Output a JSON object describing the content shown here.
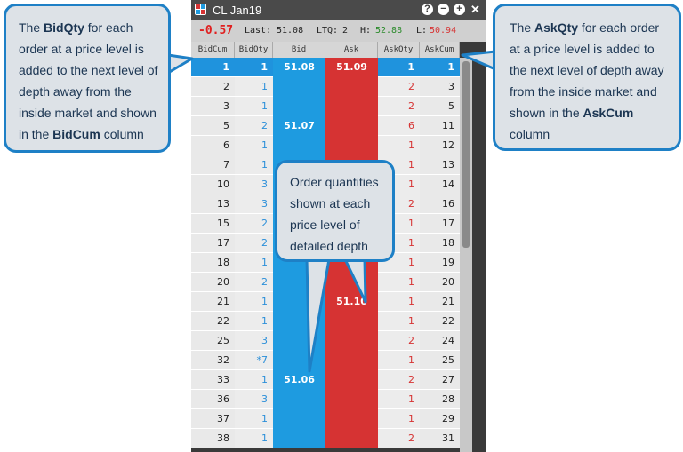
{
  "window": {
    "title": "CL Jan19",
    "controls": [
      {
        "name": "help-icon",
        "glyph": "?"
      },
      {
        "name": "minimize-icon",
        "glyph": "−"
      },
      {
        "name": "add-icon",
        "glyph": "+"
      },
      {
        "name": "close-icon",
        "glyph": "✕"
      }
    ]
  },
  "stats": {
    "net_change": "-0.57",
    "last_label": "Last:",
    "last_value": "51.08",
    "ltq_label": "LTQ:",
    "ltq_value": "2",
    "high_label": "H:",
    "high_value": "52.88",
    "low_label": "L:",
    "low_value": "50.94"
  },
  "columns": [
    "BidCum",
    "BidQty",
    "Bid",
    "Ask",
    "AskQty",
    "AskCum"
  ],
  "rows": [
    {
      "bidcum": "1",
      "bidqty": "1",
      "bid": "51.08",
      "ask": "51.09",
      "askqty": "1",
      "askcum": "1",
      "inside": true
    },
    {
      "bidcum": "2",
      "bidqty": "1",
      "bid": "",
      "ask": "",
      "askqty": "2",
      "askcum": "3"
    },
    {
      "bidcum": "3",
      "bidqty": "1",
      "bid": "",
      "ask": "",
      "askqty": "2",
      "askcum": "5"
    },
    {
      "bidcum": "5",
      "bidqty": "2",
      "bid": "51.07",
      "ask": "",
      "askqty": "6",
      "askcum": "11"
    },
    {
      "bidcum": "6",
      "bidqty": "1",
      "bid": "",
      "ask": "",
      "askqty": "1",
      "askcum": "12"
    },
    {
      "bidcum": "7",
      "bidqty": "1",
      "bid": "",
      "ask": "",
      "askqty": "1",
      "askcum": "13"
    },
    {
      "bidcum": "10",
      "bidqty": "3",
      "bid": "",
      "ask": "",
      "askqty": "1",
      "askcum": "14"
    },
    {
      "bidcum": "13",
      "bidqty": "3",
      "bid": "",
      "ask": "",
      "askqty": "2",
      "askcum": "16"
    },
    {
      "bidcum": "15",
      "bidqty": "2",
      "bid": "",
      "ask": "",
      "askqty": "1",
      "askcum": "17"
    },
    {
      "bidcum": "17",
      "bidqty": "2",
      "bid": "",
      "ask": "",
      "askqty": "1",
      "askcum": "18"
    },
    {
      "bidcum": "18",
      "bidqty": "1",
      "bid": "",
      "ask": "",
      "askqty": "1",
      "askcum": "19"
    },
    {
      "bidcum": "20",
      "bidqty": "2",
      "bid": "",
      "ask": "",
      "askqty": "1",
      "askcum": "20"
    },
    {
      "bidcum": "21",
      "bidqty": "1",
      "bid": "",
      "ask": "51.10",
      "askqty": "1",
      "askcum": "21"
    },
    {
      "bidcum": "22",
      "bidqty": "1",
      "bid": "",
      "ask": "",
      "askqty": "1",
      "askcum": "22"
    },
    {
      "bidcum": "25",
      "bidqty": "3",
      "bid": "",
      "ask": "",
      "askqty": "2",
      "askcum": "24"
    },
    {
      "bidcum": "32",
      "bidqty": "*7",
      "bid": "",
      "ask": "",
      "askqty": "1",
      "askcum": "25"
    },
    {
      "bidcum": "33",
      "bidqty": "1",
      "bid": "51.06",
      "ask": "",
      "askqty": "2",
      "askcum": "27"
    },
    {
      "bidcum": "36",
      "bidqty": "3",
      "bid": "",
      "ask": "",
      "askqty": "1",
      "askcum": "28"
    },
    {
      "bidcum": "37",
      "bidqty": "1",
      "bid": "",
      "ask": "",
      "askqty": "1",
      "askcum": "29"
    },
    {
      "bidcum": "38",
      "bidqty": "1",
      "bid": "",
      "ask": "",
      "askqty": "2",
      "askcum": "31"
    }
  ],
  "callouts": {
    "left": {
      "pre": "The ",
      "bold1": "BidQty",
      "mid": " for each order at a price level is added to the next level of depth away from the inside market and shown in the ",
      "bold2": "BidCum",
      "post": " column"
    },
    "right": {
      "pre": "The ",
      "bold1": "AskQty",
      "mid": " for each order at a price level is added to the next level of depth away from the inside market and shown in the ",
      "bold2": "AskCum",
      "post": " column"
    },
    "center": {
      "text": "Order quantities shown at each price level of detailed depth"
    }
  },
  "colors": {
    "bid": "#1e9be0",
    "ask": "#d63333",
    "callout_border": "#1e80c6"
  }
}
